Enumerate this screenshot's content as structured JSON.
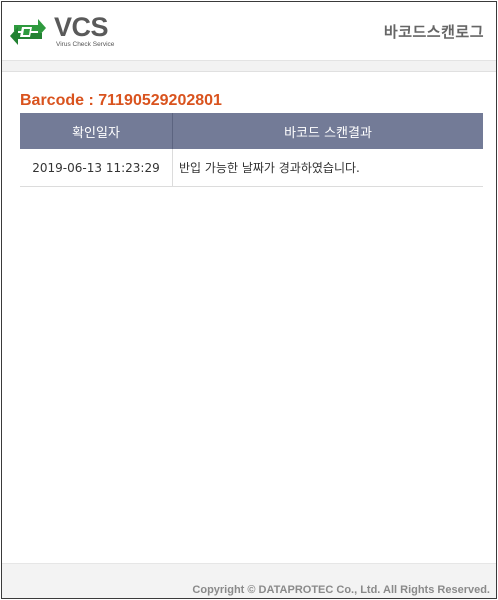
{
  "header": {
    "logo_text": "VCS",
    "logo_tagline": "Virus Check Service",
    "title": "바코드스캔로그"
  },
  "barcode_label": "Barcode : 71190529202801",
  "table": {
    "columns": [
      "확인일자",
      "바코드 스캔결과"
    ],
    "rows": [
      {
        "date": "2019-06-13 11:23:29",
        "result": "반입 가능한 날짜가 경과하였습니다."
      }
    ]
  },
  "footer": {
    "copyright": "Copyright © DATAPROTEC Co., Ltd. All Rights Reserved."
  },
  "colors": {
    "brand_green": "#2e9a3e",
    "barcode_orange": "#d9531e",
    "table_header": "#737b97"
  },
  "icons": [
    "vcs-logo-icon"
  ]
}
